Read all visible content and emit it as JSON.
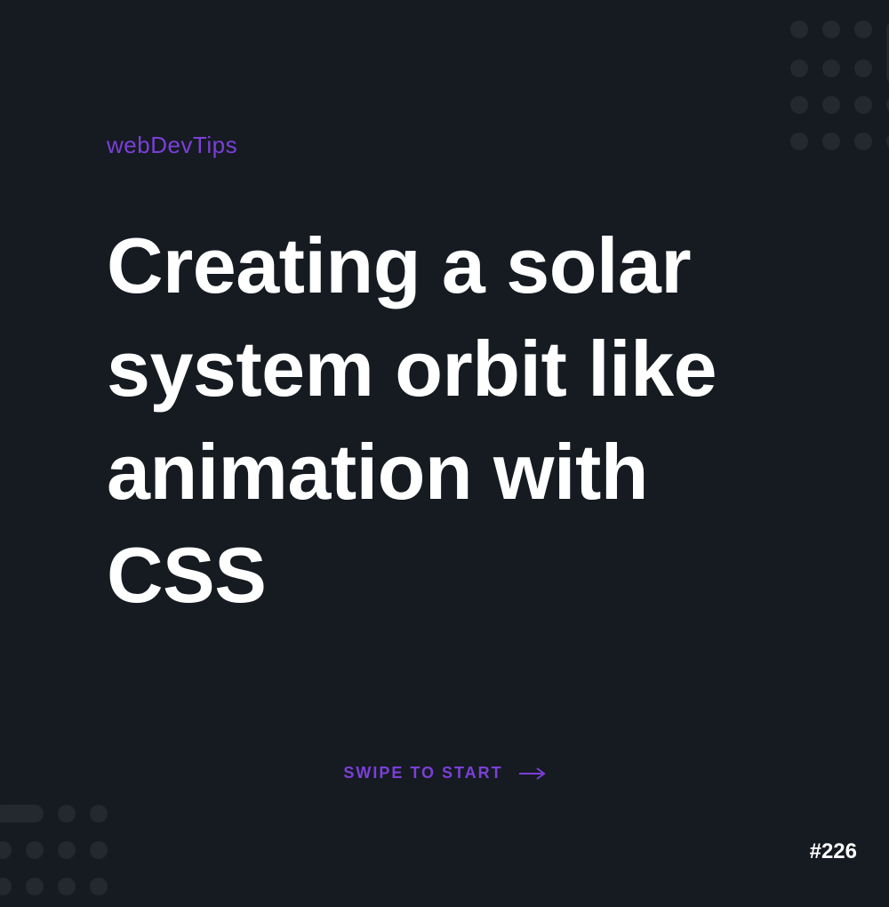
{
  "brand": "webDevTips",
  "heading": "Creating a solar system orbit like animation with CSS",
  "cta": {
    "label": "SWIPE TO START"
  },
  "tip_number": "#226"
}
